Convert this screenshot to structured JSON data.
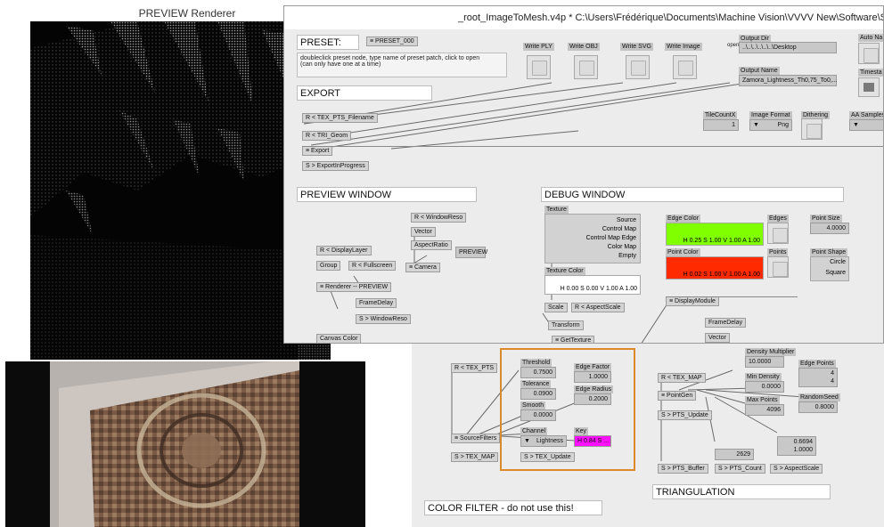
{
  "renderer": {
    "title": "PREVIEW  Renderer"
  },
  "patch": {
    "title": "_root_ImageToMesh.v4p *  C:\\Users\\Frédérique\\Documents\\Machine Vision\\VVVV New\\Software\\Subpat",
    "preset": {
      "header": "PRESET:",
      "button": "PRESET_000",
      "help": [
        "doubleclick preset node, type name of preset patch, click to open",
        "(can only have one at a time)"
      ]
    },
    "export": {
      "header": "EXPORT",
      "write_ply": "Write PLY",
      "write_obj": "Write OBJ",
      "write_svg": "Write SVG",
      "write_image": "Write Image",
      "output_dir_label": "Output Dir",
      "output_dir_open": "open",
      "output_dir_value": "..\\..\\..\\..\\..\\..\\Desktop",
      "output_name_label": "Output Name",
      "output_name_value": "Zamora_Lightness_Th0,75_To0,...",
      "auto_label": "Auto Na",
      "timestamp_label": "Timesta",
      "r_tex_pts_filename": "R  <  TEX_PTS_Filename",
      "r_tri_geom": "R  <  TRI_Geom",
      "export_node": "Export",
      "s_export_in_progress": "S  >  ExportInProgress",
      "tilecount_label": "TileCountX",
      "tilecount_value": "1",
      "image_format_label": "Image Format",
      "image_format_value": "Png",
      "dithering_label": "Dithering",
      "aa_samples_label": "AA Samples"
    },
    "preview": {
      "header": "PREVIEW WINDOW",
      "r_window_reso": "R  <  WindowReso",
      "vector": "Vector",
      "aspect_ratio": "AspectRatio",
      "r_display_layer": "R  <  DisplayLayer",
      "group": "Group",
      "r_fullscreen": "R  <  Fullscreen",
      "camera": "Camera",
      "preview_label": "PREVIEW",
      "renderer": "Renderer  --  PREVIEW",
      "frame_delay": "FrameDelay",
      "s_window_reso": "S  >  WindowReso",
      "canvas_color": "Canvas Color"
    },
    "debug": {
      "header": "DEBUG WINDOW",
      "texture_label": "Texture",
      "texture_options": [
        "Source",
        "Control Map",
        "Control Map Edge",
        "Color Map",
        "Empty"
      ],
      "texture_color_label": "Texture Color",
      "texture_color_value": "H 0.00  S 0.00  V 1.00  A 1.00",
      "edge_color_label": "Edge Color",
      "edge_color_value": "H 0.25  S 1.00  V 1.00  A 1.00",
      "edge_color": "#80ff00",
      "point_color_label": "Point Color",
      "point_color_value": "H 0.02  S 1.00  V 1.00  A 1.00",
      "point_color": "#ff2a00",
      "edges_label": "Edges",
      "points_label": "Points",
      "point_size_label": "Point Size",
      "point_size_value": "4.0000",
      "point_shape_label": "Point Shape",
      "point_shape_options": [
        "Circle",
        "Square"
      ],
      "scale": "Scale",
      "r_aspect_scale": "R  <  AspectScale",
      "transform": "Transform",
      "get_texture": "GetTexture",
      "display_module": "DisplayModule",
      "frame_delay": "FrameDelay",
      "vector": "Vector"
    }
  },
  "lower": {
    "r_tex_pts": "R  <  TEX_PTS",
    "threshold_label": "Threshold",
    "threshold_value": "0.7500",
    "tolerance_label": "Tolerance",
    "tolerance_value": "0.0900",
    "smooth_label": "Smooth",
    "smooth_value": "0.0000",
    "channel_label": "Channel",
    "channel_value": "Lightness",
    "edge_factor_label": "Edge Factor",
    "edge_factor_value": "1.0000",
    "edge_radius_label": "Edge Radius",
    "edge_radius_value": "0.2000",
    "key_label": "Key",
    "key_value": "H 0.84  S ...",
    "key_color": "#ff10ff",
    "source_filters": "SourceFilters",
    "s_tex_map": "S  >  TEX_MAP",
    "s_tex_update": "S  >  TEX_Update",
    "r_tex_map": "R  <  TEX_MAP",
    "point_gen": "PointGen",
    "s_pts_update": "S  >  PTS_Update",
    "density_mult_label": "Density Multiplier",
    "density_mult_value": "10.0000",
    "edge_points_label": "Edge Points",
    "edge_points_values": [
      "4",
      "4"
    ],
    "min_density_label": "Min Density",
    "min_density_value": "0.0000",
    "max_points_label": "Max Points",
    "max_points_value": "4096",
    "random_seed_label": "RandomSeed",
    "random_seed_value": "0.8000",
    "count_value": "2629",
    "out_values": [
      "0.6694",
      "1.0000"
    ],
    "s_pts_buffer": "S  >  PTS_Buffer",
    "s_pts_count": "S  >  PTS_Count",
    "s_aspect_scale": "S  >  AspectScale",
    "triangulation_header": "TRIANGULATION",
    "color_filter_header": "COLOR FILTER - do not use this!"
  }
}
